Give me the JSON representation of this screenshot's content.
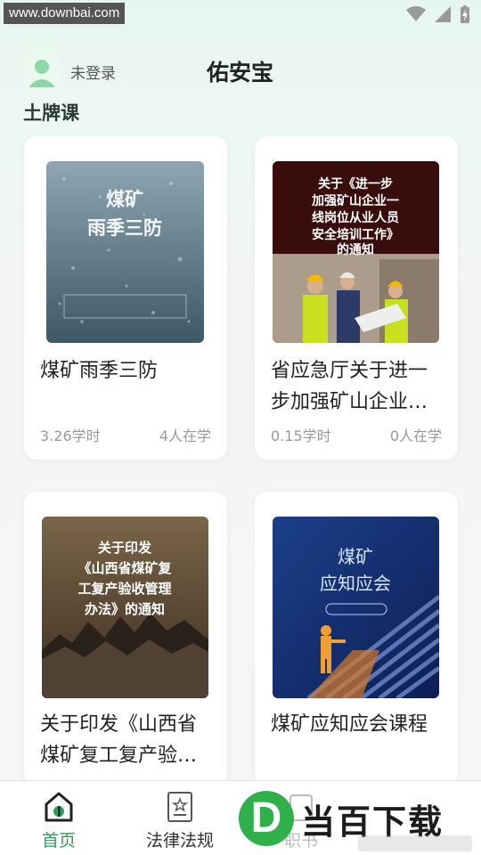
{
  "status_bar": {
    "watermark_url": "www.downbai.com",
    "icons": [
      "wifi-icon",
      "signal-icon",
      "battery-charging-icon"
    ]
  },
  "header": {
    "login_status": "未登录",
    "app_title": "佑安宝",
    "avatar_icon": "user-avatar-icon"
  },
  "section": {
    "title": "土牌课"
  },
  "courses": [
    {
      "title": "煤矿雨季三防",
      "hours": "3.26学时",
      "learners": "4人在学",
      "cover": {
        "lines": [
          "煤矿",
          "雨季三防"
        ],
        "theme": "rain-window"
      }
    },
    {
      "title": "省应急厅关于进一步加强矿山企业一线岗位从业人员安全培训工作的通知",
      "hours": "0.15学时",
      "learners": "0人在学",
      "cover": {
        "lines": [
          "关于《进一步",
          "加强矿山企业一",
          "线岗位从业人员",
          "安全培训工作》",
          "的通知"
        ],
        "theme": "workers"
      }
    },
    {
      "title": "关于印发《山西省煤矿复工复产验收管理办法》的通知",
      "hours": "",
      "learners": "",
      "cover": {
        "lines": [
          "关于印发",
          "《山西省煤矿复",
          "工复产验收管理",
          "办法》的通知"
        ],
        "theme": "mountains"
      }
    },
    {
      "title": "煤矿应知应会课程",
      "hours": "",
      "learners": "",
      "cover": {
        "lines": [
          "煤矿",
          "应知应会"
        ],
        "theme": "stairs"
      }
    }
  ],
  "bottom_nav": {
    "items": [
      {
        "label": "首页",
        "icon": "home-icon",
        "active": true
      },
      {
        "label": "法律法规",
        "icon": "law-document-icon",
        "active": false
      },
      {
        "label": "职书",
        "icon": "book-icon",
        "active": false
      }
    ]
  },
  "watermark": {
    "letter": "D",
    "text": "当百下载"
  },
  "colors": {
    "accent": "#2aa15c",
    "background_top": "#e6f6ef",
    "card": "#ffffff"
  }
}
